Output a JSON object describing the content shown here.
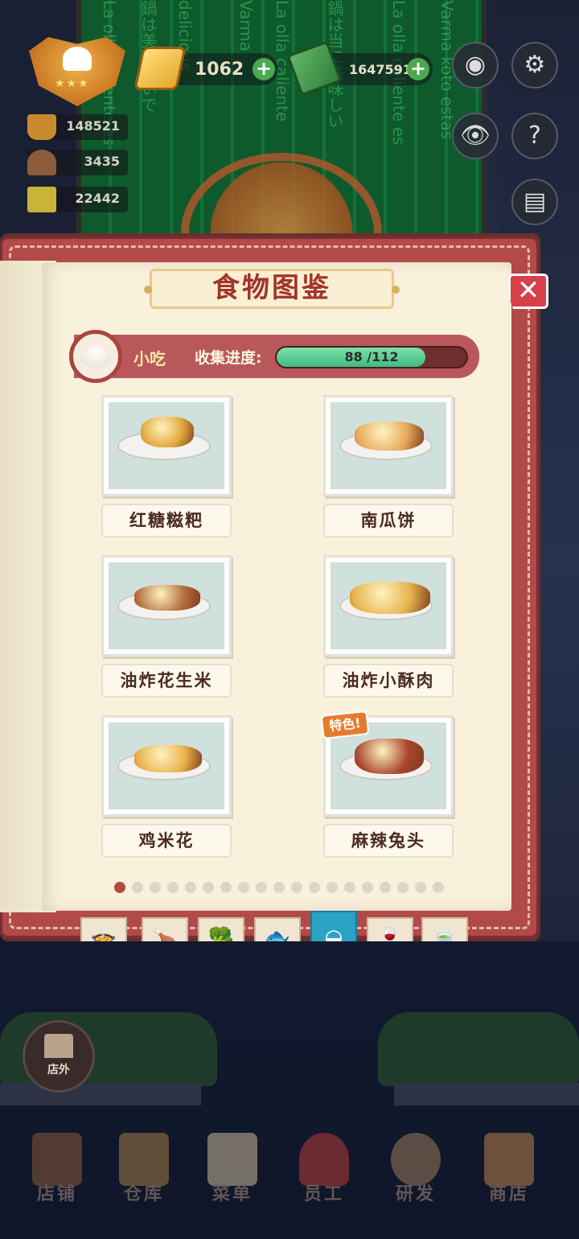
{
  "hud": {
    "gold": "1062",
    "cash": "16475912",
    "stats": [
      "148521",
      "3435",
      "22442"
    ]
  },
  "panel": {
    "title": "食物图鉴",
    "category_name": "小吃",
    "progress_label": "收集进度:",
    "progress_current": "88",
    "progress_total": "/112",
    "progress_fraction": 0.786
  },
  "foods": [
    {
      "name": "红糖糍粑",
      "color": "#e2a93b"
    },
    {
      "name": "南瓜饼",
      "color": "#e7a95c"
    },
    {
      "name": "油炸花生米",
      "color": "#b5703e"
    },
    {
      "name": "油炸小酥肉",
      "color": "#e6b24c"
    },
    {
      "name": "鸡米花",
      "color": "#eab04a"
    },
    {
      "name": "麻辣兔头",
      "color": "#a9452d",
      "tag": "特色!"
    }
  ],
  "pagination": {
    "total": 19,
    "active": 0
  },
  "tabs": [
    {
      "name": "wok-icon",
      "glyph": "🍲"
    },
    {
      "name": "drumstick-icon",
      "glyph": "🍗"
    },
    {
      "name": "broccoli-icon",
      "glyph": "🥦"
    },
    {
      "name": "fish-icon",
      "glyph": "🐟"
    },
    {
      "name": "bun-icon",
      "glyph": "◒"
    },
    {
      "name": "wine-glass-icon",
      "glyph": "🍷"
    },
    {
      "name": "soup-bowl-icon",
      "glyph": "🍵"
    }
  ],
  "active_tab": 4,
  "outside_label": "店外",
  "bottom_nav": [
    "店铺",
    "仓库",
    "菜单",
    "员工",
    "研发",
    "商店"
  ],
  "colors": {
    "accent": "#b54a44",
    "progress": "#3ebb82",
    "active_tab": "#2aa3c4"
  }
}
